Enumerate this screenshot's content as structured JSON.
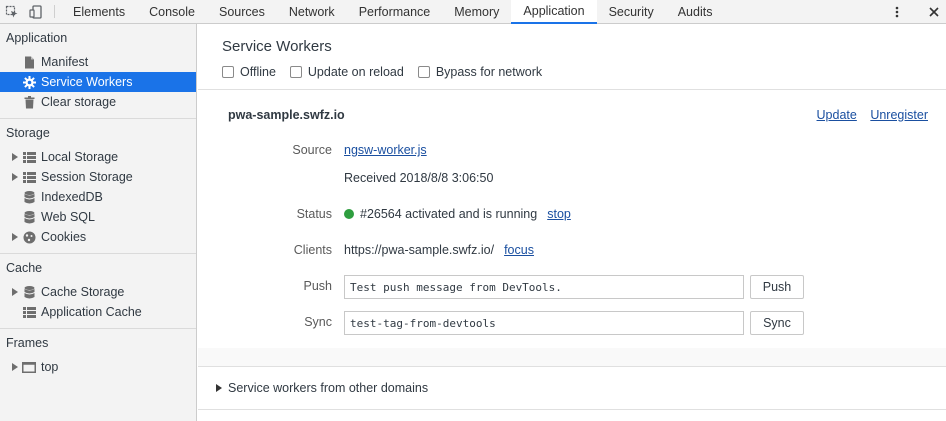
{
  "toolbar": {
    "tabs": [
      "Elements",
      "Console",
      "Sources",
      "Network",
      "Performance",
      "Memory",
      "Application",
      "Security",
      "Audits"
    ],
    "active_tab": "Application",
    "inspect_icon": "inspect-element-icon",
    "device_icon": "device-toolbar-icon",
    "menu_icon": "kebab-menu-icon",
    "close_icon": "close-icon"
  },
  "sidebar": {
    "application": {
      "header": "Application",
      "items": [
        "Manifest",
        "Service Workers",
        "Clear storage"
      ]
    },
    "storage": {
      "header": "Storage",
      "items": [
        "Local Storage",
        "Session Storage",
        "IndexedDB",
        "Web SQL",
        "Cookies"
      ]
    },
    "cache": {
      "header": "Cache",
      "items": [
        "Cache Storage",
        "Application Cache"
      ]
    },
    "frames": {
      "header": "Frames",
      "items": [
        "top"
      ]
    }
  },
  "main": {
    "title": "Service Workers",
    "options": [
      "Offline",
      "Update on reload",
      "Bypass for network"
    ],
    "origin": "pwa-sample.swfz.io",
    "update_link": "Update",
    "unregister_link": "Unregister",
    "source_label": "Source",
    "source_file": "ngsw-worker.js",
    "received": "Received 2018/8/8 3:06:50",
    "status_label": "Status",
    "status_text": "#26564 activated and is running",
    "stop_link": "stop",
    "clients_label": "Clients",
    "clients_url": "https://pwa-sample.swfz.io/",
    "focus_link": "focus",
    "push_label": "Push",
    "push_value": "Test push message from DevTools.",
    "push_button": "Push",
    "sync_label": "Sync",
    "sync_value": "test-tag-from-devtools",
    "sync_button": "Sync",
    "other_domains": "Service workers from other domains"
  },
  "colors": {
    "accent": "#1a73e8",
    "status_running": "#2e9e3f",
    "link": "#1a4fa0"
  }
}
